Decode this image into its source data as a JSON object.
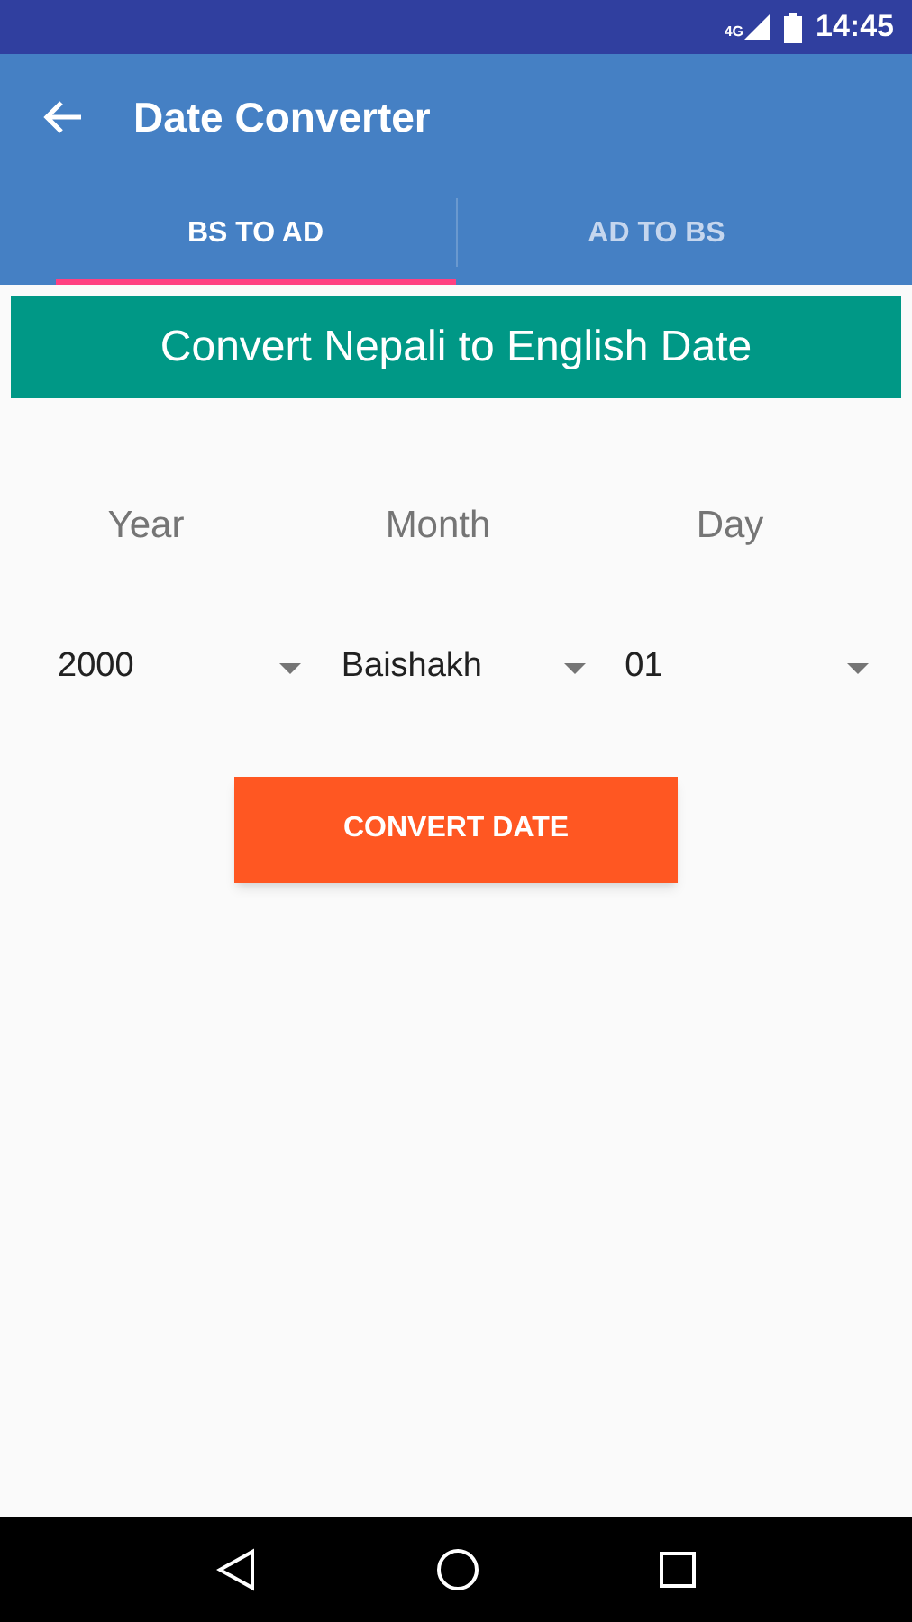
{
  "status_bar": {
    "network": "4G",
    "time": "14:45"
  },
  "app_bar": {
    "title": "Date Converter"
  },
  "tabs": [
    {
      "label": "BS TO AD",
      "selected": true
    },
    {
      "label": "AD TO BS",
      "selected": false
    }
  ],
  "banner": "Convert Nepali to English Date",
  "fields": [
    {
      "label": "Year",
      "value": "2000"
    },
    {
      "label": "Month",
      "value": "Baishakh"
    },
    {
      "label": "Day",
      "value": "01"
    }
  ],
  "button": "CONVERT DATE"
}
